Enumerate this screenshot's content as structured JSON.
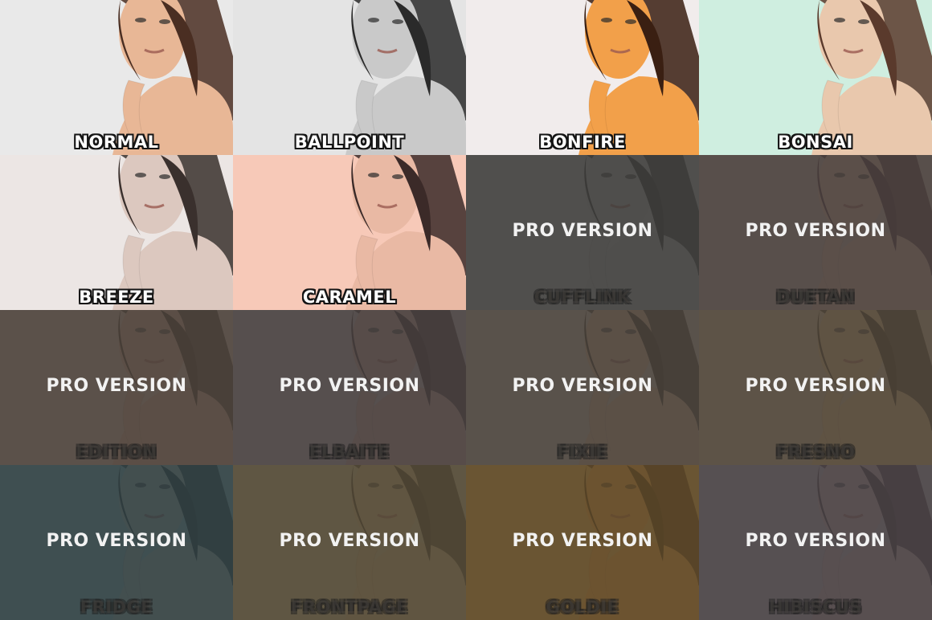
{
  "tiles": [
    {
      "name": "NORMAL",
      "bg": "#e9e9e9",
      "skin": "#e8b796",
      "hair": "#4a2e22",
      "locked": false
    },
    {
      "name": "BALLPOINT",
      "bg": "#e4e4e4",
      "skin": "#c9c9c9",
      "hair": "#2a2a2a",
      "locked": false
    },
    {
      "name": "BONFIRE",
      "bg": "#f1ecec",
      "skin": "#f2a04a",
      "hair": "#3a1f12",
      "locked": false
    },
    {
      "name": "BONSAI",
      "bg": "#cfeee0",
      "skin": "#e9c8ad",
      "hair": "#5a3a2c",
      "locked": false
    },
    {
      "name": "BREEZE",
      "bg": "#ece6e4",
      "skin": "#dcc8bf",
      "hair": "#3a302d",
      "locked": false
    },
    {
      "name": "CARAMEL",
      "bg": "#f7c9b8",
      "skin": "#e9b9a4",
      "hair": "#3b2a28",
      "locked": false
    },
    {
      "name": "CUFFLINK",
      "bg": "#bdbdbd",
      "skin": "#b5b5b5",
      "hair": "#2a2a2a",
      "locked": true,
      "tint": "rgba(62,60,58,0.86)"
    },
    {
      "name": "DUETAN",
      "bg": "#c8b8b0",
      "skin": "#d8b8a6",
      "hair": "#4a2f3a",
      "locked": true,
      "tint": "rgba(70,62,58,0.86)"
    },
    {
      "name": "EDITION",
      "bg": "#c9b8a8",
      "skin": "#caa58c",
      "hair": "#3a2a22",
      "locked": true,
      "tint": "rgba(72,64,58,0.86)"
    },
    {
      "name": "ELBAITE",
      "bg": "#c2b8b4",
      "skin": "#c9a596",
      "hair": "#3a2828",
      "locked": true,
      "tint": "rgba(68,62,60,0.86)"
    },
    {
      "name": "FIXIE",
      "bg": "#cbbcae",
      "skin": "#d8ae90",
      "hair": "#3a2a20",
      "locked": true,
      "tint": "rgba(70,64,58,0.86)"
    },
    {
      "name": "FRESNO",
      "bg": "#cbbaa0",
      "skin": "#dcb48a",
      "hair": "#3e2c1e",
      "locked": true,
      "tint": "rgba(74,66,56,0.86)"
    },
    {
      "name": "FRIDGE",
      "bg": "#9fb6b8",
      "skin": "#b9b4aa",
      "hair": "#2c3433",
      "locked": true,
      "tint": "rgba(48,62,64,0.86)"
    },
    {
      "name": "FRONTPAGE",
      "bg": "#c3b493",
      "skin": "#cfae84",
      "hair": "#3a2e1c",
      "locked": true,
      "tint": "rgba(78,70,54,0.86)"
    },
    {
      "name": "GOLDIE",
      "bg": "#d3ad6a",
      "skin": "#e4a458",
      "hair": "#3e2a10",
      "locked": true,
      "tint": "rgba(88,70,42,0.86)"
    },
    {
      "name": "HIBISCUS",
      "bg": "#b8b0b2",
      "skin": "#c4a8a2",
      "hair": "#3a2a2e",
      "locked": true,
      "tint": "rgba(70,64,66,0.86)"
    }
  ],
  "pro_label": "PRO VERSION"
}
